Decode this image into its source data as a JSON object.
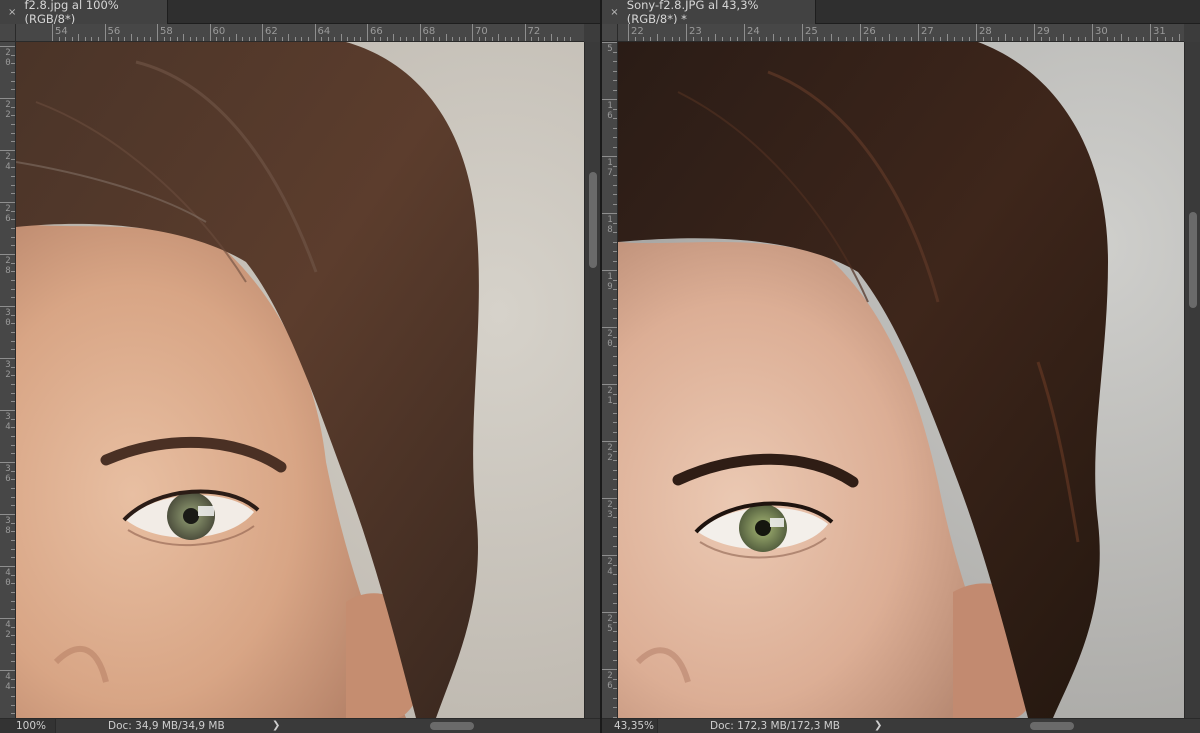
{
  "left": {
    "tab_title": "f2.8.jpg al 100% (RGB/8*)",
    "ruler_h": [
      "54",
      "56",
      "58",
      "60",
      "62",
      "64",
      "66",
      "68",
      "70",
      "72"
    ],
    "ruler_v": [
      "20",
      "22",
      "24",
      "26",
      "28",
      "30",
      "32",
      "34",
      "36",
      "38",
      "40",
      "42",
      "44"
    ],
    "zoom": "100%",
    "doc_size": "Doc: 34,9 MB/34,9 MB",
    "arrow": "❯"
  },
  "right": {
    "tab_title": "Sony-f2.8.JPG al 43,3% (RGB/8*) *",
    "ruler_h": [
      "22",
      "23",
      "24",
      "25",
      "26",
      "27",
      "28",
      "29",
      "30",
      "31"
    ],
    "ruler_v": [
      "5",
      "16",
      "17",
      "18",
      "19",
      "20",
      "21",
      "22",
      "23",
      "24",
      "25",
      "26"
    ],
    "zoom": "43,35%",
    "doc_size": "Doc: 172,3 MB/172,3 MB",
    "arrow": "❯"
  },
  "close_glyph": "×",
  "colors": {
    "panel": "#3c3c3c",
    "ruler": "#474747",
    "tab": "#424242",
    "text": "#d6d6d6"
  }
}
